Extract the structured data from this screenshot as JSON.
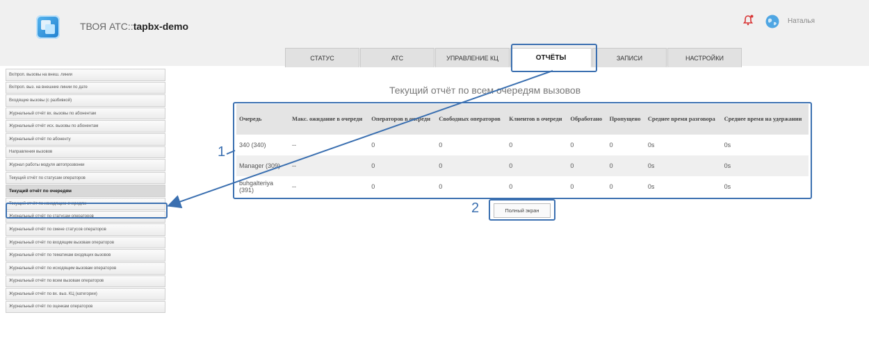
{
  "header": {
    "title_prefix": "ТВОЯ АТС::",
    "title_bold": "tapbx-demo",
    "user_name": "Наталья"
  },
  "tabs": [
    {
      "label": "СТАТУС",
      "active": false
    },
    {
      "label": "АТС",
      "active": false
    },
    {
      "label": "УПРАВЛЕНИЕ КЦ",
      "active": false
    },
    {
      "label": "ОТЧЁТЫ",
      "active": true
    },
    {
      "label": "ЗАПИСИ",
      "active": false
    },
    {
      "label": "НАСТРОЙКИ",
      "active": false
    }
  ],
  "sidebar": {
    "items": [
      {
        "label": "Вх/проп. вызовы на внеш. линии",
        "active": false
      },
      {
        "label": "Вх/проп. выз. на внешние линии по дате",
        "active": false
      },
      {
        "label": "Входящие вызовы (с разбивкой)",
        "active": false
      },
      {
        "label": "Журнальный отчёт вх. вызовы по абонентам",
        "active": false
      },
      {
        "label": "Журнальный отчёт исх. вызовы по абонентам",
        "active": false
      },
      {
        "label": "Журнальный отчёт по абоненту",
        "active": false
      },
      {
        "label": "Направления вызовов",
        "active": false
      },
      {
        "label": "Журнал работы модуля автопрозвонки",
        "active": false
      },
      {
        "label": "Текущий отчёт по статусам операторов",
        "active": false
      },
      {
        "label": "Текущий отчёт по очередям",
        "active": true
      },
      {
        "label": "Текущий отчёт по исходящим очередям",
        "active": false
      },
      {
        "label": "Журнальный отчёт по статусам операторов",
        "active": false
      },
      {
        "label": "Журнальный отчёт по смене статусов операторов",
        "active": false
      },
      {
        "label": "Журнальный отчёт по входящим вызовам операторов",
        "active": false
      },
      {
        "label": "Журнальный отчёт по тематикам входящих вызовов",
        "active": false
      },
      {
        "label": "Журнальный отчёт по исходящим вызовам операторов",
        "active": false
      },
      {
        "label": "Журнальный отчёт по всем вызовам операторов",
        "active": false
      },
      {
        "label": "Журнальный отчёт по вх. выз. КЦ (категории)",
        "active": false
      },
      {
        "label": "Журнальный отчёт по оценкам операторов",
        "active": false
      }
    ]
  },
  "main": {
    "title": "Текущий отчёт по всем очередям вызовов",
    "columns": [
      "Очередь",
      "Макс. ожидание в очереди",
      "Операторов в очереди",
      "Свободных операторов",
      "Клиентов в очереди",
      "Обработано",
      "Пропущено",
      "Среднее время разговора",
      "Среднее время на удержании"
    ],
    "rows": [
      [
        "340 (340)",
        "--",
        "0",
        "0",
        "0",
        "0",
        "0",
        "0s",
        "0s"
      ],
      [
        "Manager (309)",
        "--",
        "0",
        "0",
        "0",
        "0",
        "0",
        "0s",
        "0s"
      ],
      [
        "buhgalteriya (391)",
        "--",
        "0",
        "0",
        "0",
        "0",
        "0",
        "0s",
        "0s"
      ]
    ],
    "fullscreen_label": "Полный экран"
  },
  "annotations": {
    "callout_1": "1",
    "callout_2": "2",
    "color": "#3a6fb0"
  },
  "colors": {
    "tab_bg": "#e1e1e1",
    "header_bg": "#f0f0f0",
    "table_header_bg": "#e4e4e4"
  },
  "icons": {
    "logo": "app-logo-icon",
    "alert": "bell-alert-icon",
    "globe": "globe-icon"
  }
}
